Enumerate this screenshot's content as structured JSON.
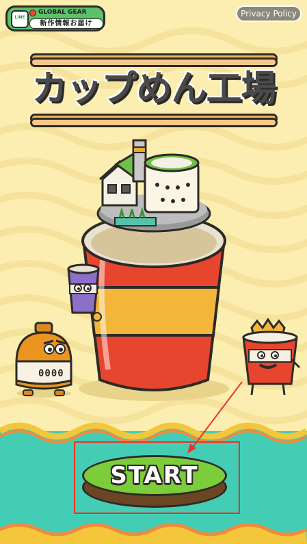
{
  "line_badge": {
    "logo_text": "LINE",
    "brand": "GLOBAL GEAR",
    "subtitle": "新作情報お届け"
  },
  "privacy_button": {
    "label": "Privacy Policy"
  },
  "title": {
    "text": "カップめん工場"
  },
  "characters": {
    "left_tank_counter": "0000"
  },
  "start_button": {
    "label": "START"
  },
  "colors": {
    "background": "#fbeeb0",
    "teal": "#44cdb5",
    "start_green": "#7ccd3a",
    "highlight_red": "#e8332a"
  }
}
